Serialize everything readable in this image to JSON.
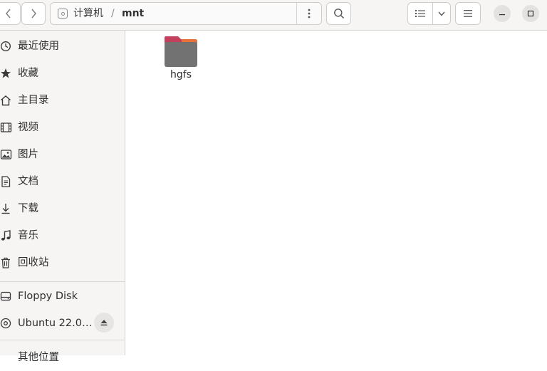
{
  "path_bar": {
    "root_label": "计算机",
    "separator": "/",
    "current_folder": "mnt"
  },
  "sidebar": {
    "items": [
      {
        "label": "最近使用",
        "icon": "clock-icon"
      },
      {
        "label": "收藏",
        "icon": "star-icon"
      },
      {
        "label": "主目录",
        "icon": "home-icon"
      },
      {
        "label": "视频",
        "icon": "film-icon"
      },
      {
        "label": "图片",
        "icon": "image-icon"
      },
      {
        "label": "文档",
        "icon": "document-icon"
      },
      {
        "label": "下载",
        "icon": "download-icon"
      },
      {
        "label": "音乐",
        "icon": "music-icon"
      },
      {
        "label": "回收站",
        "icon": "trash-icon"
      }
    ],
    "devices": [
      {
        "label": "Floppy Disk",
        "icon": "floppy-drive-icon"
      },
      {
        "label": "Ubuntu 22.0…",
        "icon": "optical-disc-icon"
      }
    ],
    "other_locations": "其他位置"
  },
  "files": [
    {
      "name": "hgfs",
      "type": "folder"
    }
  ],
  "colors": {
    "header_bg": "#f6f5f4",
    "sidebar_bg": "#f6f5f4",
    "folder_body": "#727272",
    "folder_tab": "#c3405d",
    "folder_tab_accent": "#e8703a"
  }
}
